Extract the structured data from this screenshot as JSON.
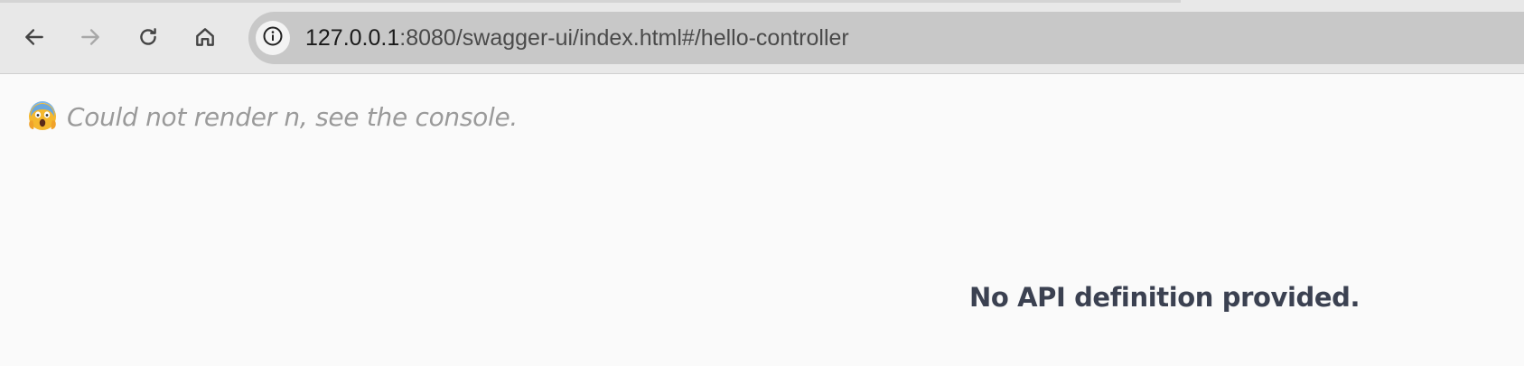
{
  "browser": {
    "url_host": "127.0.0.1",
    "url_rest": ":8080/swagger-ui/index.html#/hello-controller",
    "nav_icons": [
      "back-arrow-icon",
      "forward-arrow-icon",
      "reload-icon",
      "home-icon"
    ],
    "site_info_icon": "info-icon",
    "forward_enabled": false
  },
  "page": {
    "error_emoji": "screaming-face-icon",
    "error_message": "Could not render n, see the console.",
    "no_api_message": "No API definition provided."
  },
  "colors": {
    "toolbar_bg": "#e8e8e8",
    "omnibox_bg": "#c8c8c8",
    "page_bg": "#fafafa",
    "error_text": "#9a9a9a",
    "heading_text": "#3b4151"
  }
}
